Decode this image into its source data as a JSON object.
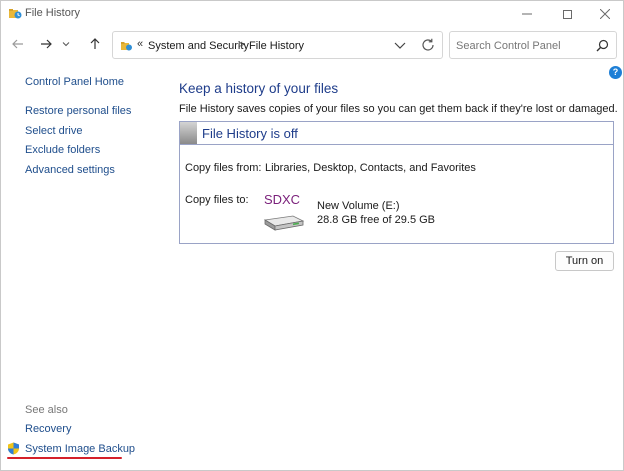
{
  "window": {
    "title": "File History"
  },
  "address": {
    "breadcrumbs": [
      "System and Security",
      "File History"
    ],
    "chevrons": [
      "«",
      ">"
    ]
  },
  "search": {
    "placeholder": "Search Control Panel"
  },
  "left_pane": {
    "home": "Control Panel Home",
    "links": [
      "Restore personal files",
      "Select drive",
      "Exclude folders",
      "Advanced settings"
    ],
    "see_also_label": "See also",
    "see_also": [
      "Recovery",
      "System Image Backup"
    ]
  },
  "main": {
    "title": "Keep a history of your files",
    "description": "File History saves copies of your files so you can get them back if they're lost or damaged.",
    "status": "File History is off",
    "copy_from_label": "Copy files from:",
    "copy_from_value": "Libraries, Desktop, Contacts, and Favorites",
    "copy_to_label": "Copy files to:",
    "drive_logo_text": "SDXC",
    "drive_name": "New Volume (E:)",
    "drive_free": "28.8 GB free of 29.5 GB",
    "turn_on_label": "Turn on"
  },
  "colors": {
    "link": "#1f4e8c",
    "heading": "#1e3c8a",
    "panel_border": "#9aa3c6",
    "highlight_underline": "#d4202a",
    "sdxc_purple": "#7a1f7a"
  },
  "icons": {
    "title": "file-history-icon",
    "back": "arrow-left-icon",
    "forward": "arrow-right-icon",
    "recent": "chevron-down-icon",
    "up": "arrow-up-icon",
    "address": "control-panel-icon",
    "dropdown": "chevron-down-icon",
    "refresh": "refresh-icon",
    "search": "search-icon",
    "help": "help-icon",
    "shield": "uac-shield-icon",
    "drive": "sdxc-drive-icon"
  }
}
